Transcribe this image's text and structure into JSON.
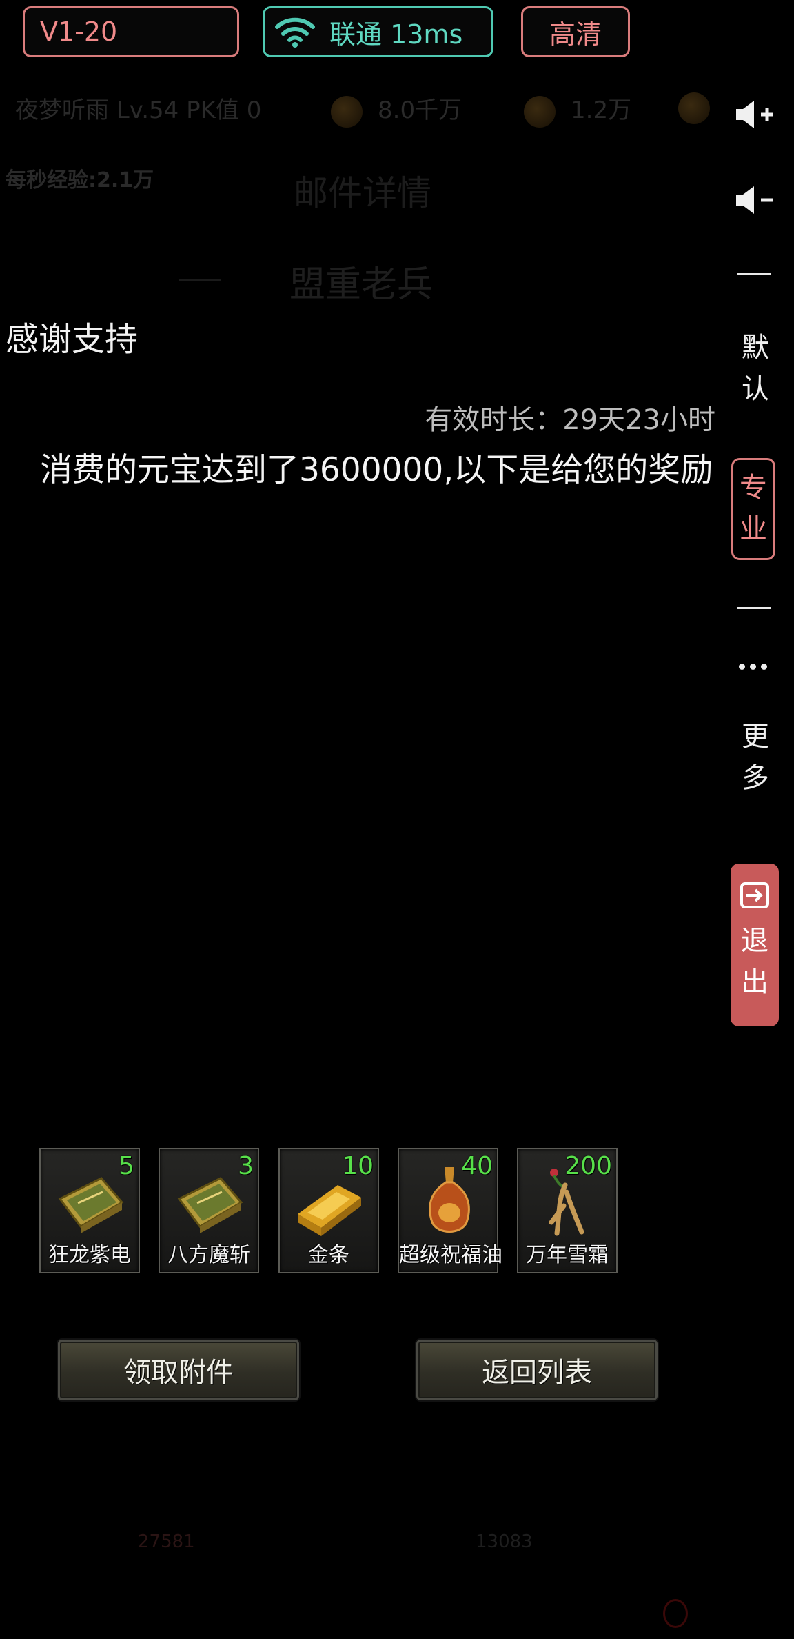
{
  "status_bar": {
    "version": "V1-20",
    "network": "联通 13ms",
    "quality": "高清"
  },
  "background_hud": {
    "player": "夜梦听雨 Lv.54 PK值 0",
    "coins": "8.0千万",
    "gems": "1.2万",
    "exp_rate": "每秒经验:2.1万",
    "title_top": "邮件详情",
    "title_mid": "盟重老兵",
    "bottom_left": "27581",
    "bottom_right": "13083"
  },
  "mail": {
    "title": "感谢支持",
    "validity": "有效时长：29天23小时",
    "body": "消费的元宝达到了3600000,以下是给您的奖励"
  },
  "rewards": [
    {
      "name": "狂龙紫电",
      "count": "5",
      "icon": "skill-book-icon"
    },
    {
      "name": "八方魔斩",
      "count": "3",
      "icon": "skill-book-icon"
    },
    {
      "name": "金条",
      "count": "10",
      "icon": "gold-bar-icon"
    },
    {
      "name": "超级祝福油",
      "count": "40",
      "icon": "blessing-oil-icon"
    },
    {
      "name": "万年雪霜",
      "count": "200",
      "icon": "ginseng-icon"
    }
  ],
  "buttons": {
    "claim": "领取附件",
    "back": "返回列表"
  },
  "sidebar": {
    "default_label": "默认",
    "pro_label": "专业",
    "more_label": "更多",
    "exit_label": "退出"
  },
  "colors": {
    "accent_red": "#d97c7c",
    "accent_teal": "#4fc9b2",
    "count_green": "#58e04a",
    "exit_bg": "#c85a5a"
  }
}
